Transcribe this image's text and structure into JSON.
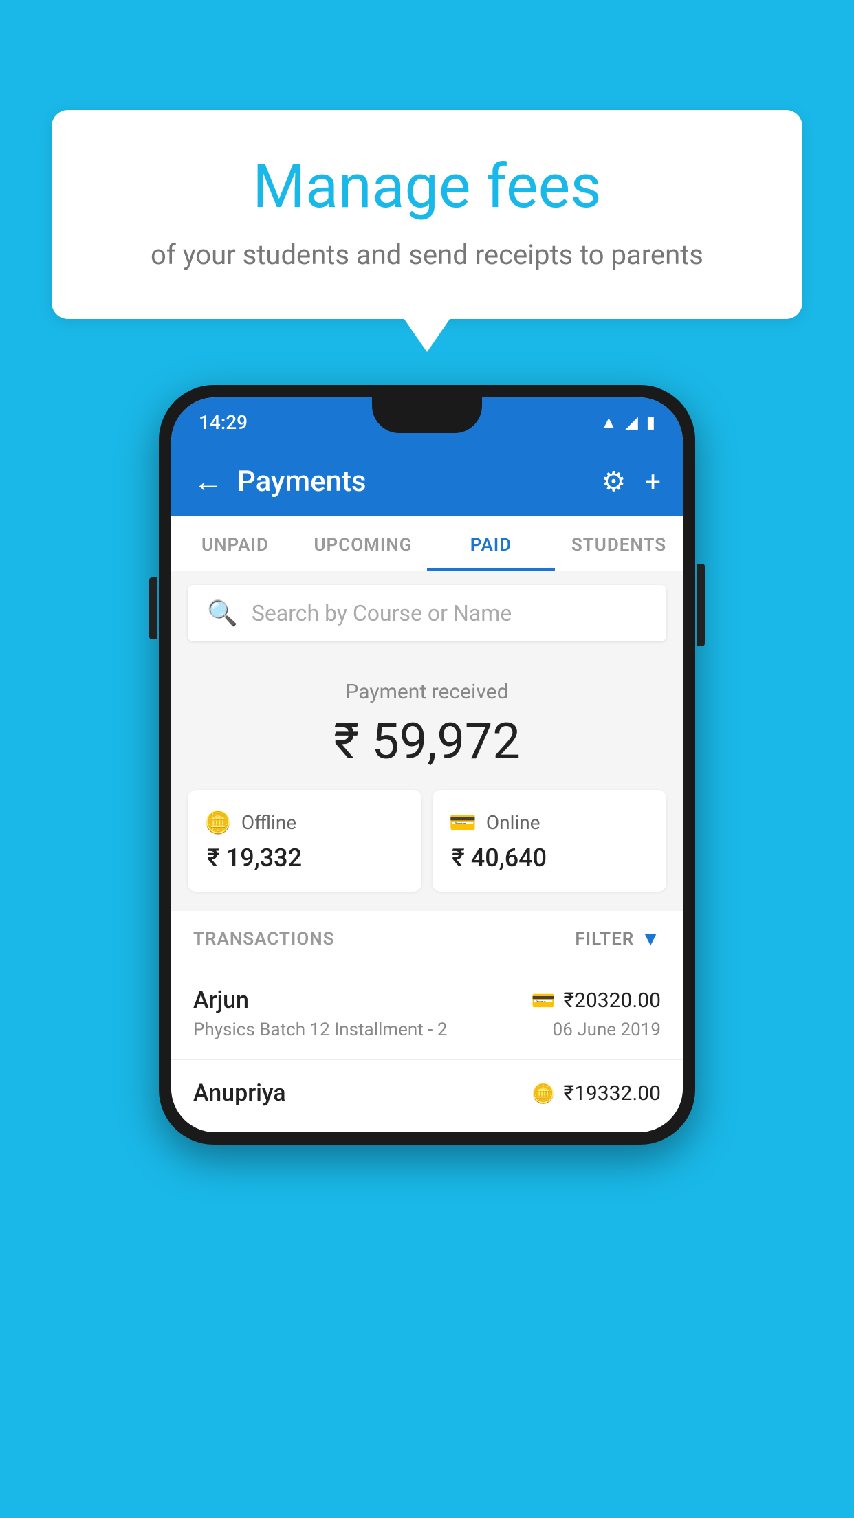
{
  "background_color": "#1ab8e8",
  "speech_bubble": {
    "title": "Manage fees",
    "subtitle": "of your students and send receipts to parents"
  },
  "status_bar": {
    "time": "14:29",
    "wifi": "▲",
    "signal": "◥",
    "battery": "▮"
  },
  "top_bar": {
    "title": "Payments",
    "back_label": "←",
    "settings_label": "⚙",
    "add_label": "+"
  },
  "tabs": [
    {
      "label": "UNPAID",
      "active": false
    },
    {
      "label": "UPCOMING",
      "active": false
    },
    {
      "label": "PAID",
      "active": true
    },
    {
      "label": "STUDENTS",
      "active": false
    }
  ],
  "search": {
    "placeholder": "Search by Course or Name",
    "icon": "🔍"
  },
  "payment_summary": {
    "label": "Payment received",
    "amount": "₹ 59,972",
    "offline": {
      "label": "Offline",
      "amount": "₹ 19,332",
      "icon": "🪙"
    },
    "online": {
      "label": "Online",
      "amount": "₹ 40,640",
      "icon": "💳"
    }
  },
  "transactions": {
    "label": "TRANSACTIONS",
    "filter_label": "FILTER",
    "rows": [
      {
        "name": "Arjun",
        "detail": "Physics Batch 12 Installment - 2",
        "amount": "₹20320.00",
        "date": "06 June 2019",
        "icon": "card"
      },
      {
        "name": "Anupriya",
        "detail": "",
        "amount": "₹19332.00",
        "date": "",
        "icon": "cash"
      }
    ]
  }
}
